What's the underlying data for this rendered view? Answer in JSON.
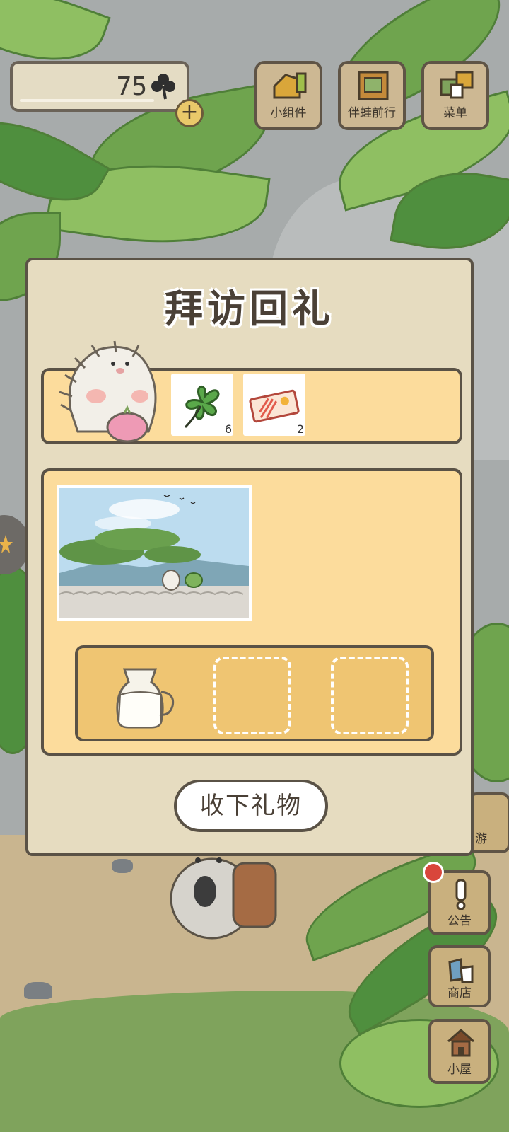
{
  "hud": {
    "clover_count": "75",
    "plus_label": "+",
    "top_buttons": [
      {
        "label": "小组件",
        "icon": "widget-icon"
      },
      {
        "label": "伴蛙前行",
        "icon": "map-book-icon"
      },
      {
        "label": "菜单",
        "icon": "menu-cards-icon"
      }
    ]
  },
  "side_buttons": [
    {
      "label": "游",
      "icon": "travel-icon"
    },
    {
      "label": "公告",
      "icon": "exclamation-icon"
    },
    {
      "label": "商店",
      "icon": "shop-bags-icon"
    },
    {
      "label": "小屋",
      "icon": "house-icon"
    }
  ],
  "dialog": {
    "title": "拜访回礼",
    "rewards": [
      {
        "name": "clover",
        "count": "6"
      },
      {
        "name": "ticket",
        "count": "2"
      }
    ],
    "gift_slots": [
      {
        "item": "milk-jug",
        "filled": true
      },
      {
        "item": "",
        "filled": false
      },
      {
        "item": "",
        "filled": false
      }
    ],
    "collect_label": "收下礼物"
  },
  "colors": {
    "dialog_bg": "#e6dcc0",
    "panel_bg": "#fcdc9c",
    "tray_bg": "#efc572",
    "border": "#5a5246",
    "notification": "#d9463b"
  }
}
